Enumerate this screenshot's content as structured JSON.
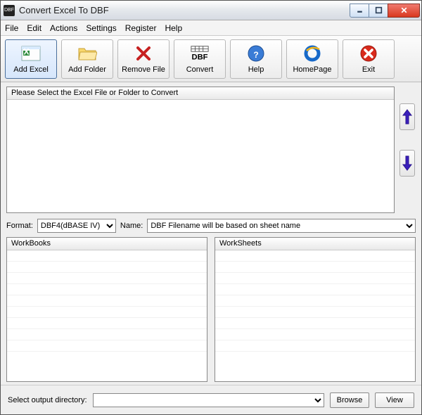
{
  "title": "Convert Excel To DBF",
  "menu": {
    "file": "File",
    "edit": "Edit",
    "actions": "Actions",
    "settings": "Settings",
    "register": "Register",
    "help": "Help"
  },
  "toolbar": {
    "add_excel": "Add Excel",
    "add_folder": "Add Folder",
    "remove_file": "Remove File",
    "convert": "Convert",
    "help": "Help",
    "homepage": "HomePage",
    "exit": "Exit"
  },
  "filelist_header": "Please Select the Excel File or Folder to Convert",
  "labels": {
    "format": "Format:",
    "name": "Name:",
    "output": "Select  output directory:"
  },
  "format_selected": "DBF4(dBASE IV)",
  "name_selected": "DBF Filename will be based on sheet name",
  "list_headers": {
    "workbooks": "WorkBooks",
    "worksheets": "WorkSheets"
  },
  "output_value": "",
  "buttons": {
    "browse": "Browse",
    "view": "View"
  }
}
